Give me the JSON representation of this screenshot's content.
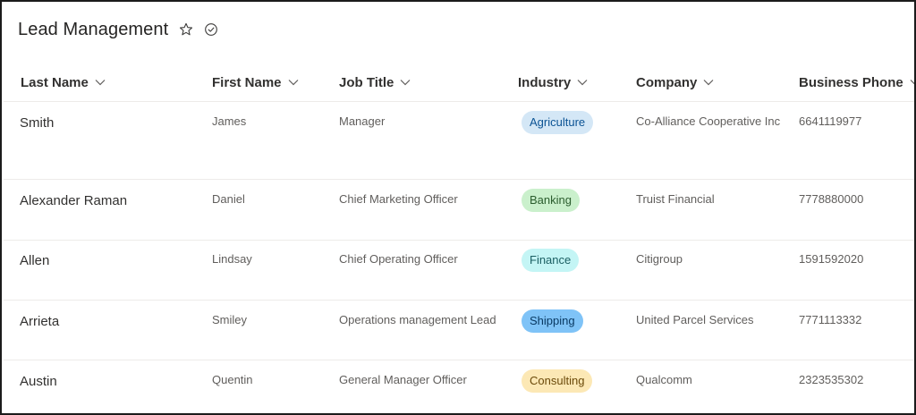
{
  "list": {
    "title": "Lead Management",
    "favorite_icon": "star-outline-icon",
    "status_icon": "check-circle-icon"
  },
  "columns": [
    {
      "key": "last_name",
      "label": "Last Name"
    },
    {
      "key": "first_name",
      "label": "First Name"
    },
    {
      "key": "job_title",
      "label": "Job Title"
    },
    {
      "key": "industry",
      "label": "Industry"
    },
    {
      "key": "company",
      "label": "Company"
    },
    {
      "key": "business_phone",
      "label": "Business Phone"
    }
  ],
  "rows": [
    {
      "last_name": "Smith",
      "first_name": "James",
      "job_title": "Manager",
      "industry": "Agriculture",
      "company": "Co-Alliance Cooperative Inc",
      "business_phone": "6641119977"
    },
    {
      "last_name": "Alexander Raman",
      "first_name": "Daniel",
      "job_title": "Chief Marketing Officer",
      "industry": "Banking",
      "company": "Truist Financial",
      "business_phone": "7778880000"
    },
    {
      "last_name": "Allen",
      "first_name": "Lindsay",
      "job_title": "Chief Operating Officer",
      "industry": "Finance",
      "company": "Citigroup",
      "business_phone": "1591592020"
    },
    {
      "last_name": "Arrieta",
      "first_name": "Smiley",
      "job_title": "Operations management Lead",
      "industry": "Shipping",
      "company": "United Parcel Services",
      "business_phone": "7771113332"
    },
    {
      "last_name": "Austin",
      "first_name": "Quentin",
      "job_title": "General Manager Officer",
      "industry": "Consulting",
      "company": "Qualcomm",
      "business_phone": "2323535302"
    }
  ],
  "industry_colors": {
    "Agriculture": {
      "bg": "#d4e7f6",
      "fg": "#0b5394"
    },
    "Banking": {
      "bg": "#caf0cc",
      "fg": "#2b5d2e"
    },
    "Finance": {
      "bg": "#c4f5f5",
      "fg": "#1b5f63"
    },
    "Shipping": {
      "bg": "#7fc3f7",
      "fg": "#0a3a63"
    },
    "Consulting": {
      "bg": "#fce8b5",
      "fg": "#6b4a0a"
    }
  }
}
